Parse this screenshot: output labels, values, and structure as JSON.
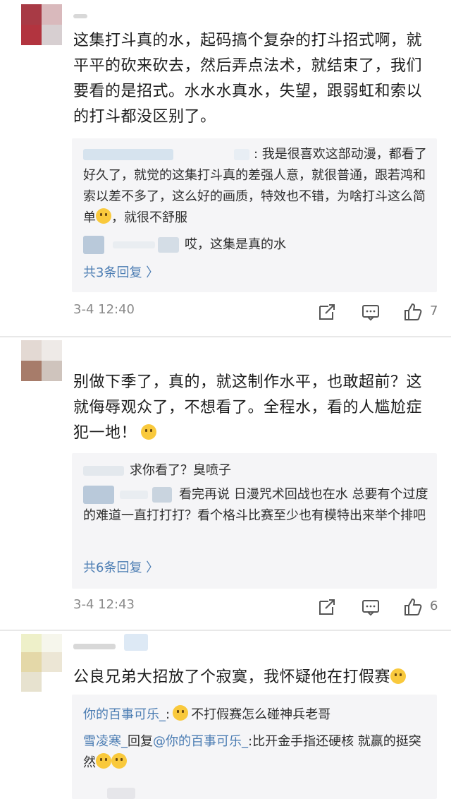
{
  "comments": [
    {
      "text": "这集打斗真的水，起码搞个复杂的打斗招式啊，就平平的砍来砍去，然后弄点法术，就结束了，我们要看的是招式。水水水真水，失望，跟弱虹和索以的打斗都没区别了。",
      "replies": [
        {
          "text": ": 我是很喜欢这部动漫，都看了好久了，就觉的这集打斗真的差强人意，就很普通，跟若鸿和索以差不多了，这么好的画质，特效也不错，为啥打斗这么简单",
          "after_emoji": "，就很不舒服"
        },
        {
          "text": "哎，这集是真的水"
        }
      ],
      "more": "共3条回复 〉",
      "time": "3-4 12:40",
      "likes": "7"
    },
    {
      "text_a": "别做下季了，真的，就这制作水平，也敢超前？这就侮辱观众了，不想看了。全程水，看的人尴尬症犯一地！",
      "replies": [
        {
          "text": "求你看了？臭喷子"
        },
        {
          "text": "看完再说  日漫咒术回战也在水 总要有个过度的难道一直打打打？看个格斗比赛至少也有模特出来举个排吧"
        }
      ],
      "more": "共6条回复 〉",
      "time": "3-4 12:43",
      "likes": "6"
    },
    {
      "text": "公良兄弟大招放了个寂寞，我怀疑他在打假赛",
      "replies": [
        {
          "name": "你的百事可乐_",
          "text": ":",
          "after_emoji": "不打假赛怎么碰神兵老哥"
        },
        {
          "name": "雪凌寒_",
          "mid": "回复",
          "mention": "@你的百事可乐_",
          "text": ":比开金手指还硬核 就赢的挺突然"
        }
      ]
    }
  ],
  "colors": {
    "link": "#4c7db3",
    "reply_bg": "#f5f5f7",
    "time": "#8a8a8a"
  }
}
